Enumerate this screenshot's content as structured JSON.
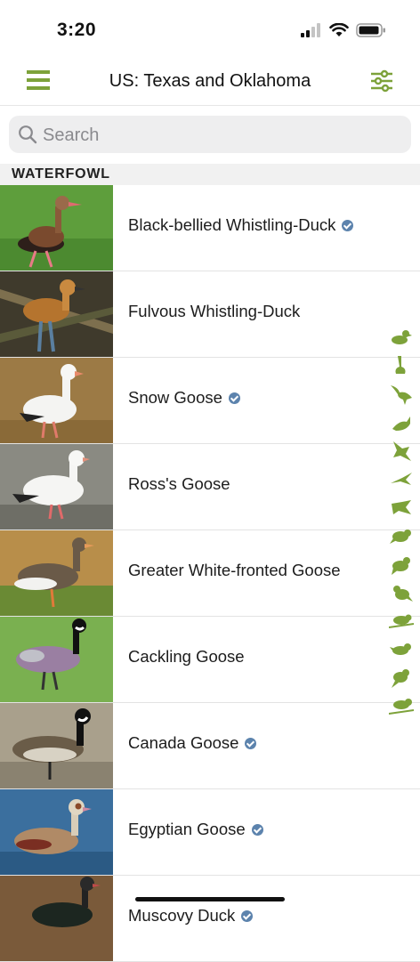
{
  "status_bar": {
    "time": "3:20"
  },
  "nav": {
    "title": "US: Texas and Oklahoma"
  },
  "search": {
    "placeholder": "Search"
  },
  "section": {
    "title": "WATERFOWL"
  },
  "birds": [
    {
      "name": "Black-bellied Whistling-Duck",
      "verified": true
    },
    {
      "name": "Fulvous Whistling-Duck",
      "verified": false
    },
    {
      "name": "Snow Goose",
      "verified": true
    },
    {
      "name": "Ross's Goose",
      "verified": false
    },
    {
      "name": "Greater White-fronted Goose",
      "verified": false
    },
    {
      "name": "Cackling Goose",
      "verified": false
    },
    {
      "name": "Canada Goose",
      "verified": true
    },
    {
      "name": "Egyptian Goose",
      "verified": true
    },
    {
      "name": "Muscovy Duck",
      "verified": true
    }
  ],
  "side_index_icons": [
    "duck-silhouette-icon",
    "grebe-silhouette-icon",
    "heron-silhouette-icon",
    "gull-silhouette-icon",
    "hawk-silhouette-icon",
    "swift-silhouette-icon",
    "woodpecker-silhouette-icon",
    "flycatcher-silhouette-icon",
    "jay-silhouette-icon",
    "thrush-silhouette-icon",
    "warbler-silhouette-icon",
    "sparrow-silhouette-icon",
    "finch-silhouette-icon",
    "blackbird-silhouette-icon"
  ],
  "colors": {
    "accent": "#7da23a",
    "verified": "#5c83ad",
    "search_bg": "#eeeeef",
    "section_bg": "#f1f1f1"
  }
}
